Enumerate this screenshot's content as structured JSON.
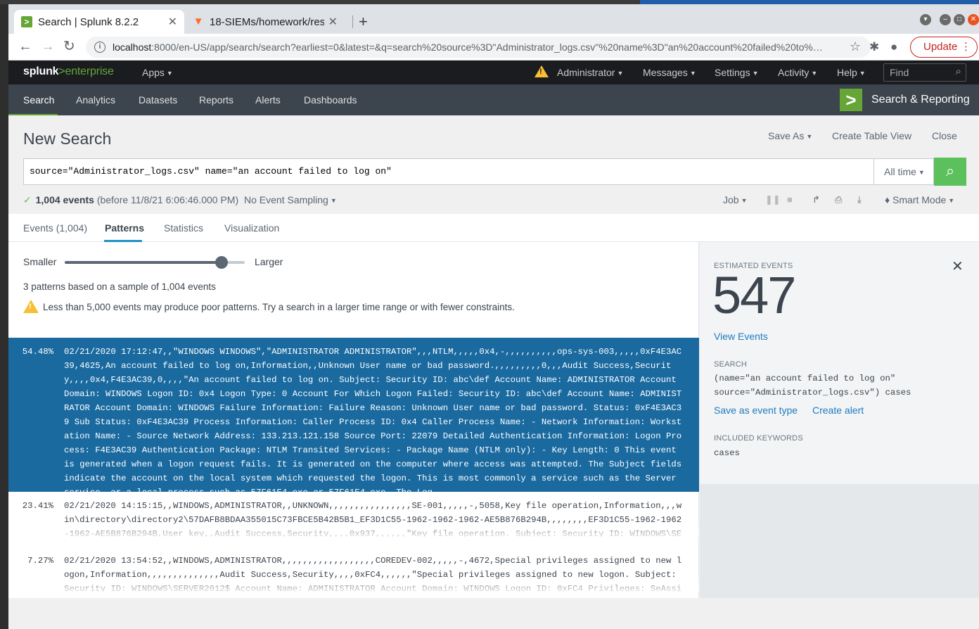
{
  "browser": {
    "tabs": [
      {
        "title": "Search | Splunk 8.2.2",
        "icon": "splunk-favicon"
      },
      {
        "title": "18-SIEMs/homework/reso",
        "icon": "gitlab-favicon"
      }
    ],
    "url_host": "localhost",
    "url_rest": ":8000/en-US/app/search/search?earliest=0&latest=&q=search%20source%3D\"Administrator_logs.csv\"%20name%3D\"an%20account%20failed%20to%…",
    "update_label": "Update"
  },
  "splunk": {
    "logo_main": "splunk",
    "logo_gt": ">",
    "logo_sub": "enterprise",
    "top_menu": {
      "apps": "Apps",
      "administrator": "Administrator",
      "messages": "Messages",
      "settings": "Settings",
      "activity": "Activity",
      "help": "Help",
      "find_placeholder": "Find"
    },
    "app_nav": [
      "Search",
      "Analytics",
      "Datasets",
      "Reports",
      "Alerts",
      "Dashboards"
    ],
    "app_title": "Search & Reporting"
  },
  "search": {
    "page_title": "New Search",
    "save_as": "Save As",
    "create_table_view": "Create Table View",
    "close": "Close",
    "query": "source=\"Administrator_logs.csv\" name=\"an account failed to log on\"",
    "time_range": "All time",
    "event_count": "1,004 events",
    "event_meta": "(before 11/8/21 6:06:46.000 PM)",
    "sampling": "No Event Sampling",
    "job": "Job",
    "mode": "Smart Mode"
  },
  "subtabs": [
    "Events (1,004)",
    "Patterns",
    "Statistics",
    "Visualization"
  ],
  "patterns": {
    "slider_smaller": "Smaller",
    "slider_larger": "Larger",
    "slider_value": 0.87,
    "summary": "3 patterns based on a sample of 1,004 events",
    "warning": "Less than 5,000 events may produce poor patterns. Try a search in a larger time range or with fewer constraints.",
    "rows": [
      {
        "pct": "54.48%",
        "text": "02/21/2020 17:12:47,,\"WINDOWS WINDOWS\",\"ADMINISTRATOR ADMINISTRATOR\",,,NTLM,,,,,0x4,-,,,,,,,,,,ops-sys-003,,,,,0xF4E3AC39,4625,An account failed to log on,Information,,Unknown User name or bad password.,,,,,,,,,0,,,Audit Success,Security,,,,0x4,F4E3AC39,0,,,,\"An account failed to log on. Subject: Security ID: abc\\def Account Name: ADMINISTRATOR Account Domain: WINDOWS Logon ID: 0x4 Logon Type: 0 Account For Which Logon Failed: Security ID: abc\\def Account Name: ADMINISTRATOR Account Domain: WINDOWS Failure Information: Failure Reason: Unknown User name or bad password. Status: 0xF4E3AC39 Sub Status: 0xF4E3AC39 Process Information: Caller Process ID: 0x4 Caller Process Name: - Network Information: Workstation Name: - Source Network Address: 133.213.121.158 Source Port: 22079 Detailed Authentication Information: Logon Process: F4E3AC39 Authentication Package: NTLM Transited Services: - Package Name (NTLM only): - Key Length: 0 This event is generated when a logon request fails. It is generated on the computer where access was attempted. The Subject fields indicate the account on the local system which requested the logon. This is most commonly a service such as the Server service, or a local process such as 57F61E4.exe or 57F61E4.exe. The Log"
      },
      {
        "pct": "23.41%",
        "text": "02/21/2020 14:15:15,,WINDOWS,ADMINISTRATOR,,UNKNOWN,,,,,,,,,,,,,,,,SE-001,,,,,-,5058,Key file operation,Information,,,win\\directory\\directory2\\57DAFB8BDAA355015C73FBCE5B42B5B1_EF3D1C55-1962-1962-1962-AE5B876B294B,,,,,,,,EF3D1C55-1962-1962-1962-AE5B876B294B,User key,,Audit Success,Security,,,,0x937,,,,,,\"Key file operation. Subject: Security ID: WINDOWS\\SERVER2012$ Account N"
      },
      {
        "pct": "7.27%",
        "text": "02/21/2020 13:54:52,,WINDOWS,ADMINISTRATOR,,,,,,,,,,,,,,,,,,COREDEV-002,,,,,-,4672,Special privileges assigned to new logon,Information,,,,,,,,,,,,,,Audit Success,Security,,,,0xFC4,,,,,,\"Special privileges assigned to new logon. Subject: Security ID: WINDOWS\\SERVER2012$ Account Name: ADMINISTRATOR Account Domain: WINDOWS Logon ID: 0xFC4 Privileges: SeAssignPrimaryTokenPrivil"
      }
    ]
  },
  "details": {
    "estimated_caption": "ESTIMATED EVENTS",
    "estimated_value": "547",
    "view_events": "View Events",
    "search_caption": "SEARCH",
    "search_line1": "(name=\"an account failed to log on\"",
    "search_line2": "source=\"Administrator_logs.csv\") cases",
    "save_event_type": "Save as event type",
    "create_alert": "Create alert",
    "keywords_caption": "INCLUDED KEYWORDS",
    "keywords": "cases"
  },
  "colors": {
    "splunk_green": "#65a637",
    "selected_row": "#1a6aa0",
    "link_blue": "#1e7bbf",
    "warning_yellow": "#f8be34"
  }
}
